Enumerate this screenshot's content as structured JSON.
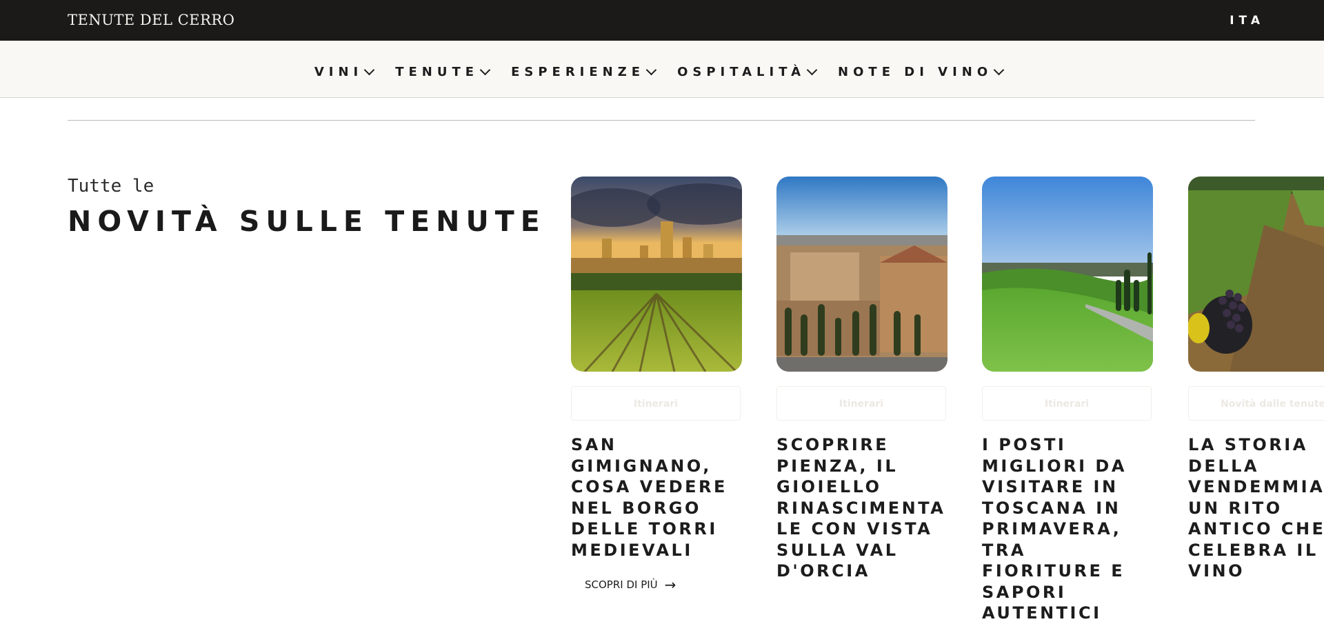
{
  "brand": {
    "logo_text": "TENUTE DEL CERRO"
  },
  "topbar": {
    "language": "ITA"
  },
  "nav": {
    "items": [
      {
        "label": "VINI"
      },
      {
        "label": "TENUTE"
      },
      {
        "label": "ESPERIENZE"
      },
      {
        "label": "OSPITALITÀ"
      },
      {
        "label": "NOTE DI VINO"
      }
    ]
  },
  "section": {
    "kicker": "Tutte le",
    "title": "NOVITÀ SULLE TENUTE"
  },
  "cards": [
    {
      "tag": "Itinerari",
      "title": "SAN GIMIGNANO, COSA VEDERE NEL BORGO DELLE TORRI MEDIEVALI",
      "link": "SCOPRI DI PIÙ",
      "image_icon": "san-gimignano-towers-image"
    },
    {
      "tag": "Itinerari",
      "title": "SCOPRIRE PIENZA, IL GIOIELLO RINASCIMENTALE CON VISTA SULLA VAL D'ORCIA",
      "link": "",
      "image_icon": "pienza-town-image"
    },
    {
      "tag": "Itinerari",
      "title": "I POSTI MIGLIORI DA VISITARE IN TOSCANA IN PRIMAVERA, TRA FIORITURE E SAPORI AUTENTICI",
      "link": "",
      "image_icon": "tuscan-hills-image"
    },
    {
      "tag": "Novità dalle tenute",
      "title": "LA STORIA DELLA VENDEMMIA, UN RITO ANTICO CHE CELEBRA IL VINO",
      "link": "",
      "image_icon": "harvest-grapes-image"
    }
  ],
  "colors": {
    "topbar_bg": "#1c1a18",
    "navbar_bg": "#faf8f4",
    "text": "#1c1c1c"
  }
}
